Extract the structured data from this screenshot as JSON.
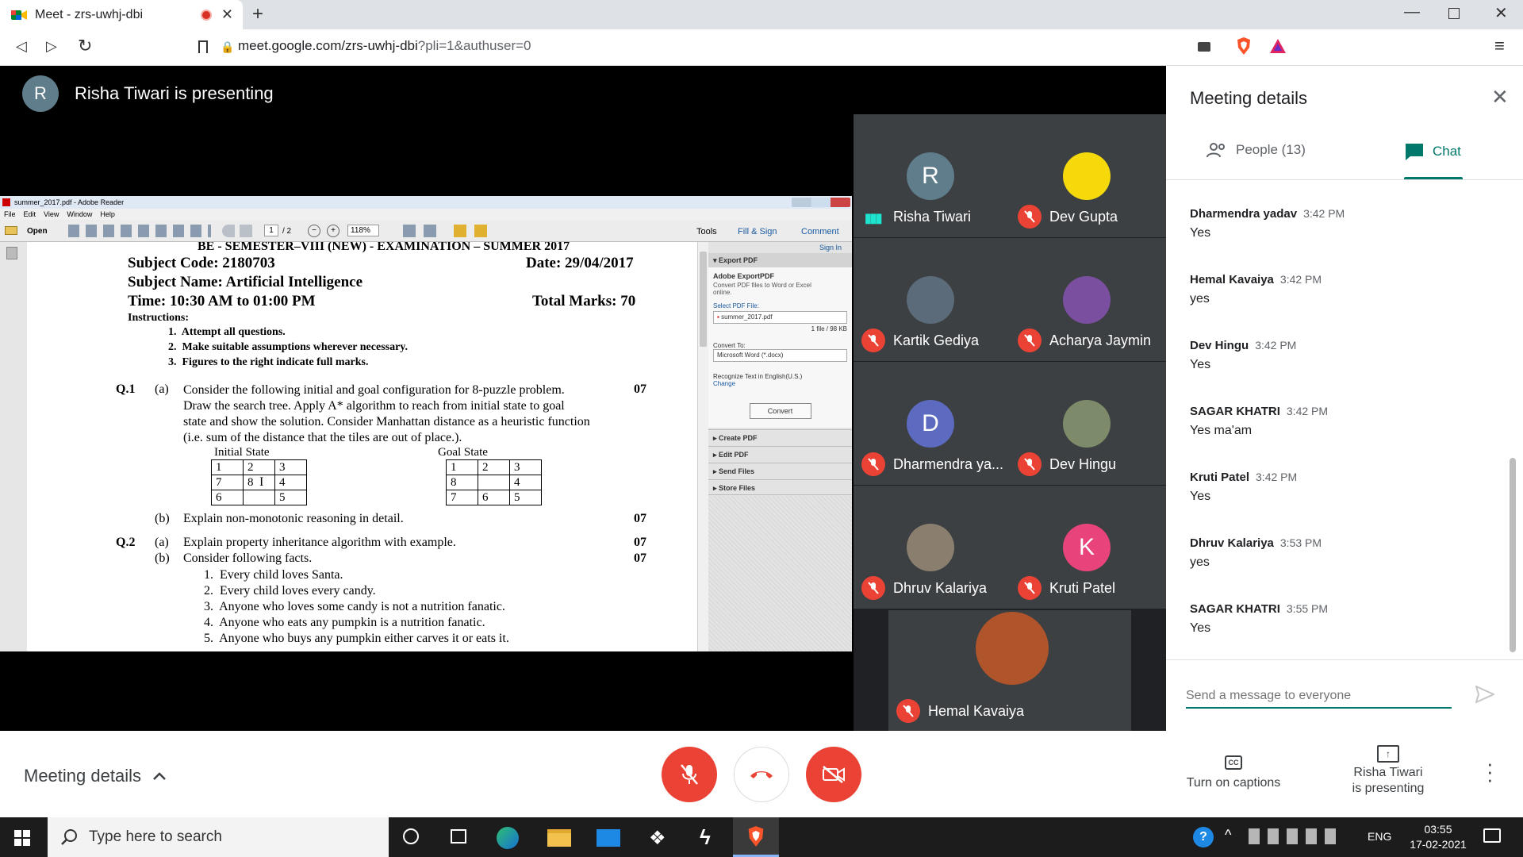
{
  "browser": {
    "tab_title": "Meet - zrs-uwhj-dbi",
    "url_main": "meet.google.com/zrs-uwhj-dbi",
    "url_query": "?pli=1&authuser=0"
  },
  "presenter": {
    "initial": "R",
    "banner_text": "Risha Tiwari is presenting"
  },
  "pdf": {
    "window_title": "summer_2017.pdf - Adobe Reader",
    "menu": [
      "File",
      "Edit",
      "View",
      "Window",
      "Help"
    ],
    "toolbar": {
      "open": "Open",
      "page": "1",
      "page_total": "/ 2",
      "zoom": "118%",
      "tools": "Tools",
      "fill_sign": "Fill & Sign",
      "comment": "Comment"
    },
    "pane": {
      "sign_in": "Sign In",
      "export_pdf": "Export PDF",
      "adobe_export": "Adobe ExportPDF",
      "export_desc": "Convert PDF files to Word or Excel online.",
      "select_file": "Select PDF File:",
      "file_name": "summer_2017.pdf",
      "file_info": "1 file / 98 KB",
      "convert_to": "Convert To:",
      "convert_format": "Microsoft Word (*.docx)",
      "recognize": "Recognize Text in English(U.S.)",
      "change": "Change",
      "convert_btn": "Convert",
      "sections": [
        "Create PDF",
        "Edit PDF",
        "Send Files",
        "Store Files"
      ]
    },
    "doc": {
      "header": "BE - SEMESTER–VIII (NEW) - EXAMINATION – SUMMER 2017",
      "subject_code": "Subject Code: 2180703",
      "date": "Date: 29/04/2017",
      "subject_name": "Subject Name: Artificial Intelligence",
      "time": "Time: 10:30 AM to 01:00 PM",
      "total_marks": "Total Marks: 70",
      "instructions": "Instructions:",
      "instr": [
        "1.  Attempt all questions.",
        "2.  Make suitable assumptions wherever necessary.",
        "3.  Figures to the right indicate full marks."
      ],
      "q1": "Q.1",
      "a": "(a)",
      "b": "(b)",
      "q1a_lines": [
        "Consider the following initial and goal configuration for 8-puzzle problem.",
        "Draw the search tree. Apply A* algorithm to reach from initial state to goal",
        "state and show the solution. Consider Manhattan distance as a heuristic function",
        "(i.e. sum of the distance that the tiles are out of place.)."
      ],
      "marks": "07",
      "initial_state": "Initial State",
      "goal_state": "Goal State",
      "initial_grid": [
        [
          "1",
          "2",
          "3"
        ],
        [
          "7",
          "8",
          "4"
        ],
        [
          "6",
          "",
          "5"
        ]
      ],
      "goal_grid": [
        [
          "1",
          "2",
          "3"
        ],
        [
          "8",
          "",
          "4"
        ],
        [
          "7",
          "6",
          "5"
        ]
      ],
      "q1b": "Explain non-monotonic reasoning in detail.",
      "q2": "Q.2",
      "q2a": "Explain property inheritance algorithm with example.",
      "q2b": "Consider following facts.",
      "facts": [
        "1.  Every child loves Santa.",
        "2.  Every child loves every candy.",
        "3.  Anyone who loves some candy is not a nutrition fanatic.",
        "4.  Anyone who eats any pumpkin is a nutrition fanatic.",
        "5.  Anyone who buys any pumpkin either carves it or eats it."
      ]
    }
  },
  "participants": [
    {
      "name": "Risha Tiwari",
      "initial": "R",
      "avatar_color": "#607d8b",
      "speaking": true
    },
    {
      "name": "Dev Gupta",
      "initial": "",
      "avatar_color": "#f5d90a",
      "speaking": false
    },
    {
      "name": "Kartik Gediya",
      "initial": "",
      "avatar_color": "#5b6b7a",
      "speaking": false
    },
    {
      "name": "Acharya Jaymin",
      "initial": "",
      "avatar_color": "#7a4fa0",
      "speaking": false
    },
    {
      "name": "Dharmendra ya...",
      "initial": "D",
      "avatar_color": "#5c6bc0",
      "speaking": false
    },
    {
      "name": "Dev Hingu",
      "initial": "",
      "avatar_color": "#7d8b6a",
      "speaking": false
    },
    {
      "name": "Dhruv Kalariya",
      "initial": "",
      "avatar_color": "#8a7f6e",
      "speaking": false
    },
    {
      "name": "Kruti Patel",
      "initial": "K",
      "avatar_color": "#e8437a",
      "speaking": false
    },
    {
      "name": "Hemal Kavaiya",
      "initial": "",
      "avatar_color": "#b0542b",
      "speaking": false
    }
  ],
  "panel": {
    "title": "Meeting details",
    "people_tab": "People (13)",
    "chat_tab": "Chat",
    "messages": [
      {
        "sender": "Dharmendra yadav",
        "time": "3:42 PM",
        "text": "Yes"
      },
      {
        "sender": "Hemal Kavaiya",
        "time": "3:42 PM",
        "text": "yes"
      },
      {
        "sender": "Dev Hingu",
        "time": "3:42 PM",
        "text": "Yes"
      },
      {
        "sender": "SAGAR KHATRI",
        "time": "3:42 PM",
        "text": "Yes ma'am"
      },
      {
        "sender": "Kruti Patel",
        "time": "3:42 PM",
        "text": "Yes"
      },
      {
        "sender": "Dhruv Kalariya",
        "time": "3:53 PM",
        "text": "yes"
      },
      {
        "sender": "SAGAR KHATRI",
        "time": "3:55 PM",
        "text": "Yes"
      }
    ],
    "input_placeholder": "Send a message to everyone"
  },
  "bottom": {
    "meeting_details": "Meeting details",
    "captions": "Turn on captions",
    "presenting_line1": "Risha Tiwari",
    "presenting_line2": "is presenting"
  },
  "taskbar": {
    "search": "Type here to search",
    "lang": "ENG",
    "time": "03:55",
    "date": "17-02-2021"
  },
  "colors": {
    "accent": "#00796b",
    "danger": "#ea4335",
    "meet_bg": "#202124"
  }
}
